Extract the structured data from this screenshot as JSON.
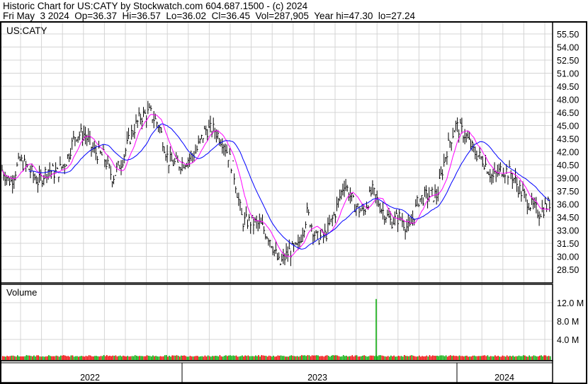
{
  "header": {
    "line1": "Historic Chart for US:CATY by Stockwatch.com 604.687.1500 - (c) 2024",
    "line2": "Fri May  3 2024  Op=36.37  Hi=36.57  Lo=36.02  Cl=36.45  Vol=287,905  Year hi=47.30  lo=27.24"
  },
  "chart_data": {
    "type": "line",
    "title": "US:CATY",
    "volume_label": "Volume",
    "price_ticks": [
      "55.50",
      "54.00",
      "52.50",
      "51.00",
      "49.50",
      "48.00",
      "46.50",
      "45.00",
      "43.50",
      "42.00",
      "40.50",
      "39.00",
      "37.50",
      "36.00",
      "34.50",
      "33.00",
      "31.50",
      "30.00",
      "28.50"
    ],
    "ylim": [
      27.0,
      56.5
    ],
    "volume_ticks": [
      "12.0 M",
      "8.0 M",
      "4.0 M"
    ],
    "volume_ylim": [
      0,
      14
    ],
    "x_labels": [
      "2022",
      "2023",
      "2024"
    ],
    "closes": [
      40,
      38.5,
      41,
      40,
      38.5,
      40,
      39.5,
      41,
      44,
      44,
      42,
      41.5,
      39,
      41,
      44,
      46,
      46.5,
      45,
      41,
      40.5,
      41,
      42,
      44.5,
      44.5,
      43,
      40,
      34,
      34,
      33.5,
      32,
      29,
      30.5,
      31,
      35,
      32,
      32.5,
      35,
      38.5,
      36,
      35,
      37.5,
      35.5,
      34,
      34.5,
      33,
      36.5,
      37,
      37,
      42,
      45,
      44,
      42,
      41,
      39,
      40,
      39.5,
      37.5,
      36,
      35,
      36
    ],
    "volume_spike_millions": 12.8,
    "series": [
      {
        "name": "short MA",
        "color": "#ff00ff"
      },
      {
        "name": "long MA",
        "color": "#0000ff"
      }
    ]
  }
}
